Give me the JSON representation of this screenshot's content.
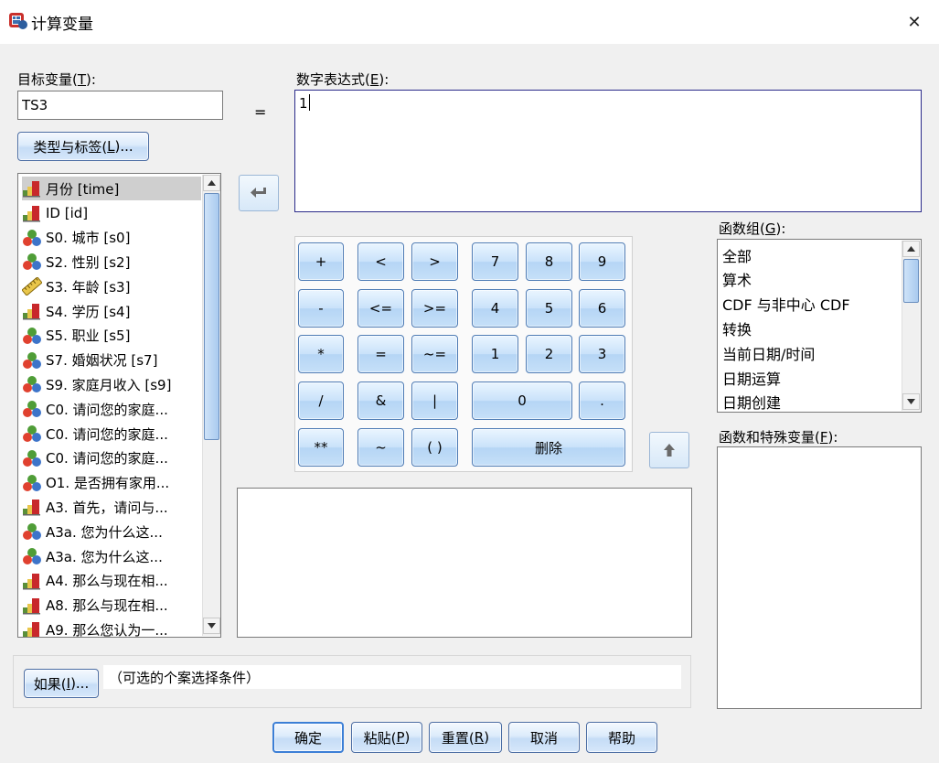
{
  "window": {
    "title": "计算变量",
    "close_glyph": "✕"
  },
  "target_var": {
    "label_prefix": "目标变量(",
    "label_key": "T",
    "label_suffix": "):",
    "value": "TS3"
  },
  "type_label_button": {
    "prefix": "类型与标签(",
    "key": "L",
    "suffix": ")..."
  },
  "equals_sign": "=",
  "numeric_expr": {
    "label_prefix": "数字表达式(",
    "label_key": "E",
    "label_suffix": "):",
    "value": "1"
  },
  "variables": [
    {
      "label": "月份 [time]",
      "icon": "scale-bar-icon",
      "selected": true
    },
    {
      "label": "ID [id]",
      "icon": "scale-bar-icon",
      "selected": false
    },
    {
      "label": "S0. 城市 [s0]",
      "icon": "nominal-icon",
      "selected": false
    },
    {
      "label": "S2. 性别 [s2]",
      "icon": "nominal-icon",
      "selected": false
    },
    {
      "label": "S3. 年龄 [s3]",
      "icon": "ruler-icon",
      "selected": false
    },
    {
      "label": "S4. 学历 [s4]",
      "icon": "scale-bar-icon",
      "selected": false
    },
    {
      "label": "S5. 职业 [s5]",
      "icon": "nominal-icon",
      "selected": false
    },
    {
      "label": "S7. 婚姻状况 [s7]",
      "icon": "nominal-icon",
      "selected": false
    },
    {
      "label": "S9. 家庭月收入 [s9]",
      "icon": "nominal-icon",
      "selected": false
    },
    {
      "label": "C0. 请问您的家庭...",
      "icon": "nominal-icon",
      "selected": false
    },
    {
      "label": "C0. 请问您的家庭...",
      "icon": "nominal-icon",
      "selected": false
    },
    {
      "label": "C0. 请问您的家庭...",
      "icon": "nominal-icon",
      "selected": false
    },
    {
      "label": "O1. 是否拥有家用...",
      "icon": "nominal-icon",
      "selected": false
    },
    {
      "label": "A3. 首先，请问与...",
      "icon": "scale-bar-icon",
      "selected": false
    },
    {
      "label": "A3a. 您为什么这...",
      "icon": "nominal-icon",
      "selected": false
    },
    {
      "label": "A3a. 您为什么这...",
      "icon": "nominal-icon",
      "selected": false
    },
    {
      "label": "A4. 那么与现在相...",
      "icon": "scale-bar-icon",
      "selected": false
    },
    {
      "label": "A8. 那么与现在相...",
      "icon": "scale-bar-icon",
      "selected": false
    },
    {
      "label": "A9. 那么您认为一...",
      "icon": "scale-bar-icon",
      "selected": false
    }
  ],
  "keypad": {
    "plus": "+",
    "lt": "<",
    "gt": ">",
    "k7": "7",
    "k8": "8",
    "k9": "9",
    "minus": "-",
    "le": "<=",
    "ge": ">=",
    "k4": "4",
    "k5": "5",
    "k6": "6",
    "mult": "*",
    "eq": "=",
    "ne": "~=",
    "k1": "1",
    "k2": "2",
    "k3": "3",
    "div": "/",
    "and": "&",
    "or": "|",
    "k0": "0",
    "dot": ".",
    "pow": "**",
    "not": "~",
    "paren": "( )",
    "delete": "删除"
  },
  "function_group": {
    "label_prefix": "函数组(",
    "label_key": "G",
    "label_suffix": "):",
    "items": [
      "全部",
      "算术",
      "CDF 与非中心 CDF",
      "转换",
      "当前日期/时间",
      "日期运算",
      "日期创建"
    ]
  },
  "functions": {
    "label_prefix": "函数和特殊变量(",
    "label_key": "F",
    "label_suffix": "):"
  },
  "if_button": {
    "prefix": "如果(",
    "key": "I",
    "suffix": ")..."
  },
  "if_condition": "（可选的个案选择条件）",
  "buttons": {
    "ok": "确定",
    "paste": {
      "prefix": "粘贴(",
      "key": "P",
      "suffix": ")"
    },
    "reset": {
      "prefix": "重置(",
      "key": "R",
      "suffix": ")"
    },
    "cancel": "取消",
    "help": "帮助"
  },
  "colors": {
    "accent_border": "#4b6da3",
    "selection": "#cfcfcf",
    "expr_border": "#2b2b8a"
  }
}
